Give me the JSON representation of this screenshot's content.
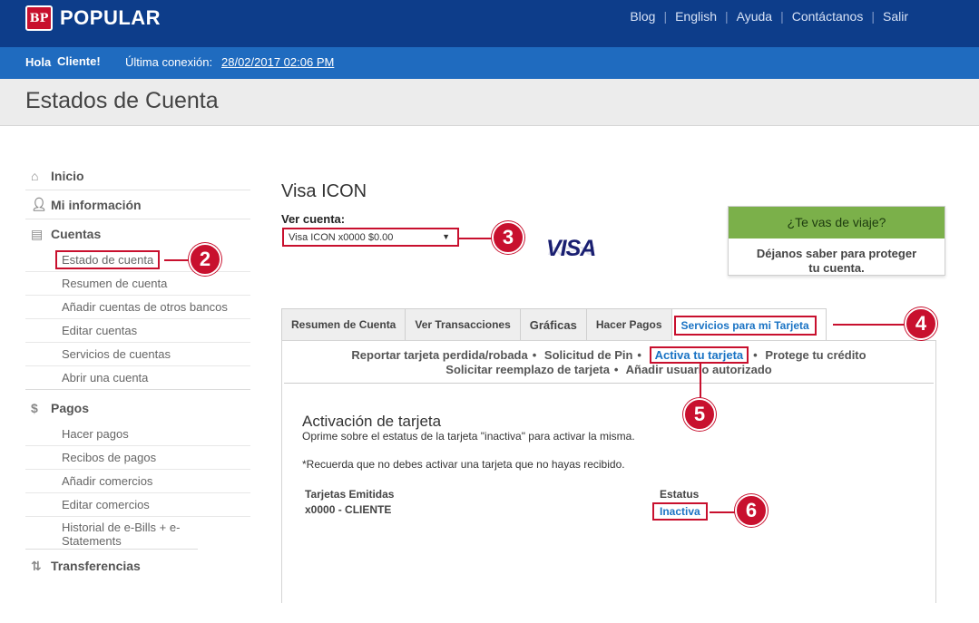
{
  "header": {
    "brand": "POPULAR",
    "brand_badge": "BP",
    "nav": [
      "Blog",
      "English",
      "Ayuda",
      "Contáctanos",
      "Salir"
    ]
  },
  "greeting": {
    "hola": "Hola",
    "user": "Cliente!",
    "last_login_label": "Última conexión:",
    "last_login_value": "28/02/2017 02:06 PM"
  },
  "page_title": "Estados de Cuenta",
  "sidebar": {
    "inicio": "Inicio",
    "mi_informacion": "Mi información",
    "cuentas": "Cuentas",
    "cuentas_items": [
      "Estado de cuenta",
      "Resumen de cuenta",
      "Añadir cuentas de otros bancos",
      "Editar cuentas",
      "Servicios de cuentas",
      "Abrir una cuenta"
    ],
    "pagos": "Pagos",
    "pagos_items": [
      "Hacer pagos",
      "Recibos de pagos",
      "Añadir comercios",
      "Editar comercios",
      "Historial de e-Bills + e-Statements"
    ],
    "transferencias": "Transferencias"
  },
  "account": {
    "title": "Visa ICON",
    "ver_cuenta_label": "Ver cuenta:",
    "selected": "Visa ICON x0000 $0.00",
    "card_logo": "VISA"
  },
  "travel": {
    "head": "¿Te vas de viaje?",
    "body_line1": "Déjanos saber para proteger",
    "body_line2": "tu cuenta."
  },
  "tabs": [
    "Resumen de Cuenta",
    "Ver Transacciones",
    "Gráficas",
    "Hacer Pagos",
    "Servicios para mi Tarjeta"
  ],
  "sublinks": {
    "row1": [
      "Reportar tarjeta perdida/robada",
      "Solicitud de Pin",
      "Activa tu tarjeta",
      "Protege tu crédito"
    ],
    "row2": [
      "Solicitar reemplazo de tarjeta",
      "Añadir usuario autorizado"
    ]
  },
  "activation": {
    "title": "Activación de tarjeta",
    "desc": "Oprime sobre el estatus de la tarjeta \"inactiva\" para activar la misma.",
    "note": "*Recuerda que no debes activar una tarjeta que no hayas recibido.",
    "col_cards": "Tarjetas Emitidas",
    "col_status": "Estatus",
    "card": "x0000 - CLIENTE",
    "status": "Inactiva"
  },
  "callouts": [
    "2",
    "3",
    "4",
    "5",
    "6"
  ],
  "colors": {
    "primary": "#0d3d8a",
    "secondary": "#1f6bbf",
    "highlight": "#c8102e",
    "link": "#1a73c4"
  }
}
